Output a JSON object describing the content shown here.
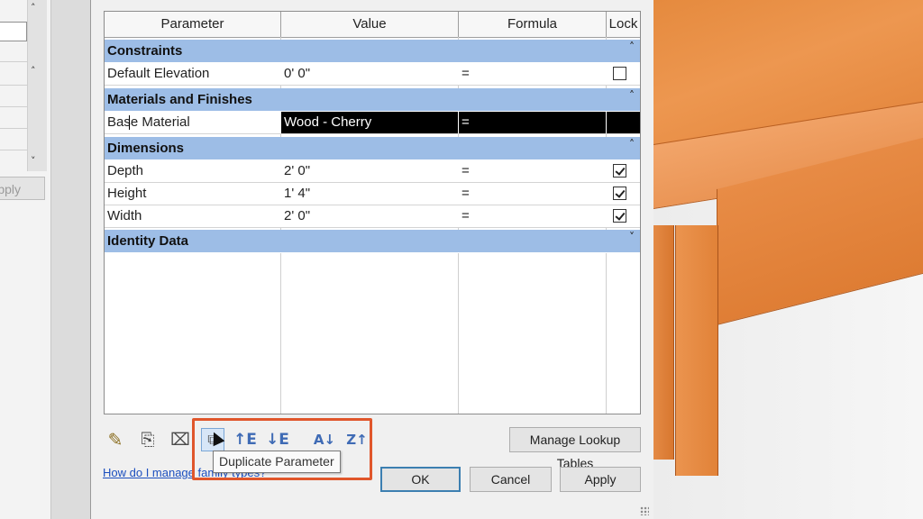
{
  "left_panel": {
    "apply_label": "pply"
  },
  "grid": {
    "headers": {
      "parameter": "Parameter",
      "value": "Value",
      "formula": "Formula",
      "lock": "Lock"
    },
    "groups": {
      "constraints": "Constraints",
      "materials": "Materials and Finishes",
      "dimensions": "Dimensions",
      "identity": "Identity Data"
    },
    "rows": {
      "default_elevation": {
        "parameter": "Default Elevation",
        "value": "0'  0\"",
        "formula": "=",
        "locked": false
      },
      "base_material": {
        "parameter": "Base Material",
        "value": "Wood - Cherry",
        "formula": "="
      },
      "depth": {
        "parameter": "Depth",
        "value": "2'  0\"",
        "formula": "=",
        "locked": true
      },
      "height": {
        "parameter": "Height",
        "value": "1'  4\"",
        "formula": "=",
        "locked": true
      },
      "width": {
        "parameter": "Width",
        "value": "2'  0\"",
        "formula": "=",
        "locked": true
      }
    }
  },
  "toolbar": {
    "icons": [
      "pencil-icon",
      "new-parameter-icon",
      "delete-parameter-icon",
      "duplicate-parameter-icon",
      "move-up-icon",
      "move-down-icon",
      "sort-ascending-icon",
      "sort-descending-icon"
    ],
    "tooltip": "Duplicate Parameter",
    "manage_lookup": "Manage Lookup Tables"
  },
  "help_link": "How do I manage family types?",
  "buttons": {
    "ok": "OK",
    "cancel": "Cancel",
    "apply": "Apply"
  },
  "colors": {
    "group_header": "#9dbde6",
    "highlight": "#e0562b",
    "wood": "#e8904f"
  }
}
